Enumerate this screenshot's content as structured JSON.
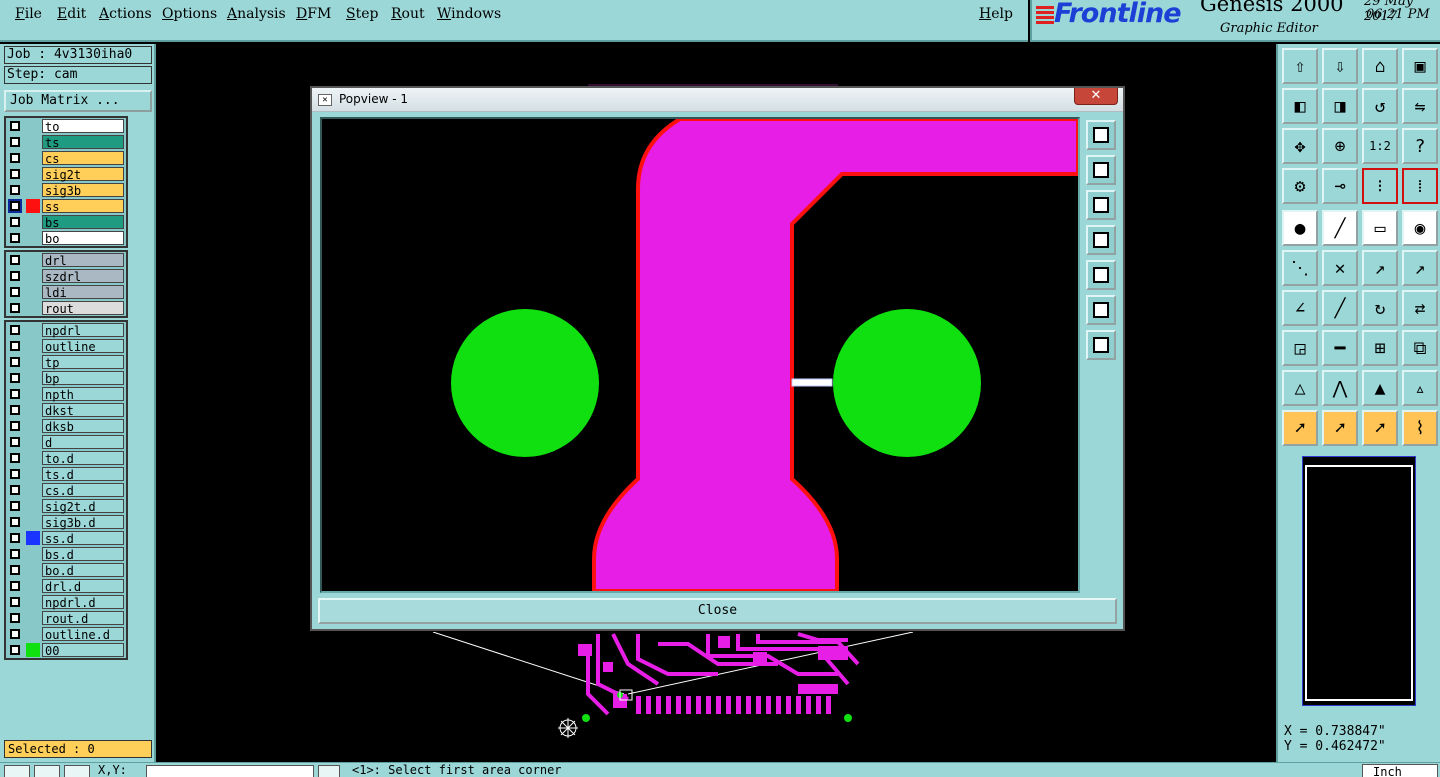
{
  "menu": {
    "items": [
      "File",
      "Edit",
      "Actions",
      "Options",
      "Analysis",
      "DFM",
      "Step",
      "Rout",
      "Windows"
    ],
    "help": "Help"
  },
  "brand": {
    "logo": "Frontline",
    "product": "Genesis 2000",
    "subtitle": "Graphic Editor",
    "date": "29 May 2017",
    "time": "06:21 PM"
  },
  "job": {
    "job_label": "Job : 4v3130iha0",
    "step_label": "Step: cam",
    "matrix_button": "Job Matrix ..."
  },
  "layer_groups": [
    [
      {
        "name": "to",
        "fill": "#ffffff"
      },
      {
        "name": "ts",
        "fill": "#1e9b80"
      },
      {
        "name": "cs",
        "fill": "#ffcf5a"
      },
      {
        "name": "sig2t",
        "fill": "#ffcf5a"
      },
      {
        "name": "sig3b",
        "fill": "#ffcf5a"
      },
      {
        "name": "ss",
        "fill": "#ffcf5a",
        "swatch": "#ff1010",
        "active": true
      },
      {
        "name": "bs",
        "fill": "#1e9b80"
      },
      {
        "name": "bo",
        "fill": "#ffffff"
      }
    ],
    [
      {
        "name": "drl",
        "fill": "#a9b8c2"
      },
      {
        "name": "szdrl",
        "fill": "#a9b8c2"
      },
      {
        "name": "ldi",
        "fill": "#a9b8c2"
      },
      {
        "name": "rout",
        "fill": "#dcdcdc"
      }
    ],
    [
      {
        "name": "npdrl",
        "fill": "#9cd7d7"
      },
      {
        "name": "outline",
        "fill": "#9cd7d7"
      },
      {
        "name": "tp",
        "fill": "#9cd7d7"
      },
      {
        "name": "bp",
        "fill": "#9cd7d7"
      },
      {
        "name": "npth",
        "fill": "#9cd7d7"
      },
      {
        "name": "dkst",
        "fill": "#9cd7d7"
      },
      {
        "name": "dksb",
        "fill": "#9cd7d7"
      },
      {
        "name": "d",
        "fill": "#9cd7d7"
      },
      {
        "name": "to.d",
        "fill": "#9cd7d7"
      },
      {
        "name": "ts.d",
        "fill": "#9cd7d7"
      },
      {
        "name": "cs.d",
        "fill": "#9cd7d7"
      },
      {
        "name": "sig2t.d",
        "fill": "#9cd7d7"
      },
      {
        "name": "sig3b.d",
        "fill": "#9cd7d7"
      },
      {
        "name": "ss.d",
        "fill": "#9cd7d7",
        "swatch": "#1a33ff"
      },
      {
        "name": "bs.d",
        "fill": "#9cd7d7"
      },
      {
        "name": "bo.d",
        "fill": "#9cd7d7"
      },
      {
        "name": "drl.d",
        "fill": "#9cd7d7"
      },
      {
        "name": "npdrl.d",
        "fill": "#9cd7d7"
      },
      {
        "name": "rout.d",
        "fill": "#9cd7d7"
      },
      {
        "name": "outline.d",
        "fill": "#9cd7d7"
      },
      {
        "name": "00",
        "fill": "#9cd7d7",
        "swatch": "#10e010"
      }
    ]
  ],
  "selected": "Selected : 0",
  "popview": {
    "title": "Popview - 1",
    "close_x": "✕",
    "close_button": "Close"
  },
  "coords": {
    "x": "X = 0.738847\"",
    "y": "Y = 0.462472\""
  },
  "bottom": {
    "xy_label": "X,Y:",
    "prompt": "<1>: Select first area corner",
    "unit": "Inch"
  },
  "colors": {
    "panel": "#9cd7d7",
    "copper_signal": "#e61ee6",
    "outline_red": "#ff1010",
    "pad_green": "#10e010"
  },
  "tools": [
    {
      "icon": "upload-icon",
      "glyph": "⇧",
      "style": "t-blue"
    },
    {
      "icon": "download-icon",
      "glyph": "⇩",
      "style": "t-blue"
    },
    {
      "icon": "home-icon",
      "glyph": "⌂",
      "style": "t-blue"
    },
    {
      "icon": "window-icon",
      "glyph": "▣",
      "style": "t-blue"
    },
    {
      "icon": "pan-left-icon",
      "glyph": "◧",
      "style": "t-blue"
    },
    {
      "icon": "pan-right-icon",
      "glyph": "◨",
      "style": "t-blue"
    },
    {
      "icon": "rotate-icon",
      "glyph": "↺",
      "style": "t-blue"
    },
    {
      "icon": "flip-icon",
      "glyph": "⇋",
      "style": "t-blue"
    },
    {
      "icon": "zoom-fit-icon",
      "glyph": "✥",
      "style": "t-blue"
    },
    {
      "icon": "zoom-center-icon",
      "glyph": "⊕",
      "style": "t-blue"
    },
    {
      "icon": "scale-icon",
      "glyph": "1:2",
      "style": "t-blue"
    },
    {
      "icon": "help-icon",
      "glyph": "?",
      "style": "t-blue"
    },
    {
      "icon": "settings-icon",
      "glyph": "⚙",
      "style": "t-blue"
    },
    {
      "icon": "key-icon",
      "glyph": "⊸",
      "style": "t-blue"
    },
    {
      "icon": "net-icon",
      "glyph": "⁝",
      "style": "t-blue t-red"
    },
    {
      "icon": "net-compare-icon",
      "glyph": "⁞",
      "style": "t-blue t-red"
    },
    {
      "icon": "pad-add-icon",
      "glyph": "●",
      "style": "t-white"
    },
    {
      "icon": "line-add-icon",
      "glyph": "╱",
      "style": "t-white"
    },
    {
      "icon": "ruler-icon",
      "glyph": "▭",
      "style": "t-white"
    },
    {
      "icon": "circle-select-icon",
      "glyph": "◉",
      "style": "t-white"
    },
    {
      "icon": "connect-icon",
      "glyph": "⋱",
      "style": "t-blue"
    },
    {
      "icon": "cross-icon",
      "glyph": "✕",
      "style": "t-blue"
    },
    {
      "icon": "move-dot-icon",
      "glyph": "↗",
      "style": "t-blue"
    },
    {
      "icon": "move-dot-2-icon",
      "glyph": "↗",
      "style": "t-blue"
    },
    {
      "icon": "angle-icon",
      "glyph": "∠",
      "style": "t-blue"
    },
    {
      "icon": "slash-icon",
      "glyph": "╱",
      "style": "t-blue"
    },
    {
      "icon": "arc-icon",
      "glyph": "↻",
      "style": "t-blue"
    },
    {
      "icon": "mirror-icon",
      "glyph": "⇄",
      "style": "t-blue"
    },
    {
      "icon": "snap-icon",
      "glyph": "◲",
      "style": "t-blue"
    },
    {
      "icon": "horizontal-line-icon",
      "glyph": "━",
      "style": "t-blue"
    },
    {
      "icon": "measure-icon",
      "glyph": "⊞",
      "style": "t-blue"
    },
    {
      "icon": "group-icon",
      "glyph": "⧉",
      "style": "t-blue"
    },
    {
      "icon": "triangle-icon",
      "glyph": "△",
      "style": "t-blue"
    },
    {
      "icon": "triangle-open-icon",
      "glyph": "⋀",
      "style": "t-blue"
    },
    {
      "icon": "triangle-filled-icon",
      "glyph": "▲",
      "style": "t-blue"
    },
    {
      "icon": "triangle-measure-icon",
      "glyph": "▵",
      "style": "t-blue"
    },
    {
      "icon": "pointer-icon",
      "glyph": "➚",
      "style": "t-orange"
    },
    {
      "icon": "pointer-box-icon",
      "glyph": "➚",
      "style": "t-orange"
    },
    {
      "icon": "pointer-octagon-icon",
      "glyph": "➚",
      "style": "t-orange"
    },
    {
      "icon": "route-icon",
      "glyph": "⌇",
      "style": "t-orange"
    }
  ],
  "popview_tools": [
    "zoom-in-icon",
    "pan-up-icon",
    "pan-down-icon",
    "pan-left-icon",
    "pan-right-icon",
    "zoom-fit-icon",
    "zoom-center-icon"
  ]
}
